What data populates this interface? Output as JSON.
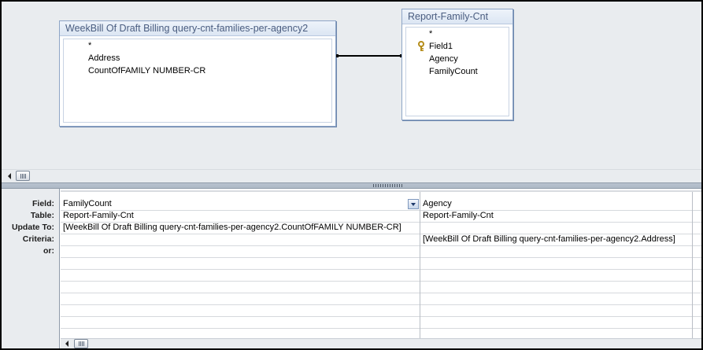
{
  "tables": [
    {
      "title": "WeekBill Of Draft Billing query-cnt-families-per-agency2",
      "fields": [
        "*",
        "Address",
        "CountOfFAMILY NUMBER-CR"
      ]
    },
    {
      "title": "Report-Family-Cnt",
      "fields": [
        "*",
        "Field1",
        "Agency",
        "FamilyCount"
      ],
      "primary_key": "Field1"
    }
  ],
  "grid": {
    "row_labels": [
      "Field:",
      "Table:",
      "Update To:",
      "Criteria:",
      "or:"
    ],
    "columns": [
      {
        "field": "FamilyCount",
        "table": "Report-Family-Cnt",
        "update_to": "[WeekBill Of Draft Billing query-cnt-families-per-agency2.CountOfFAMILY NUMBER-CR]",
        "criteria": "",
        "or": ""
      },
      {
        "field": "Agency",
        "table": "Report-Family-Cnt",
        "update_to": "",
        "criteria": "[WeekBill Of Draft Billing query-cnt-families-per-agency2.Address]",
        "or": ""
      }
    ]
  },
  "icons": {
    "key": "key-icon",
    "dropdown": "chevron-down-icon",
    "scroll_left": "scroll-left-arrow-icon",
    "scroll_thumb": "scroll-thumb-grip-icon",
    "splitter": "splitter-grip-icon"
  },
  "colors": {
    "pane_background": "#e9ecef",
    "table_title_text": "#4a5d80",
    "table_border": "#8ea5c6",
    "key_gold": "#c9a227"
  }
}
